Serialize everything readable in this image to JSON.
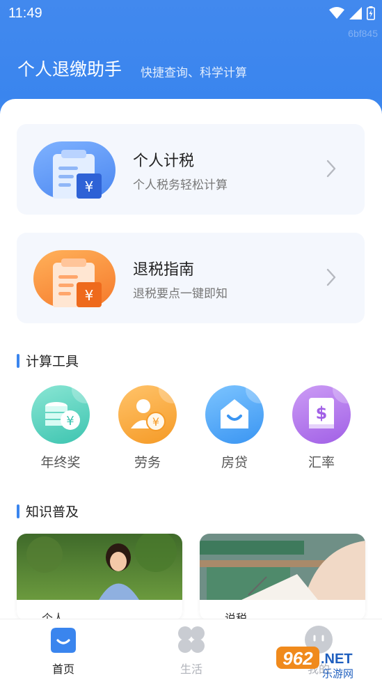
{
  "status_bar": {
    "time": "11:49"
  },
  "watermark_code": "6bf845",
  "header": {
    "title": "个人退缴助手",
    "subtitle": "快捷查询、科学计算"
  },
  "features": [
    {
      "title": "个人计税",
      "subtitle": "个人税务轻松计算",
      "icon": "tax-clipboard-icon",
      "badge": "¥"
    },
    {
      "title": "退税指南",
      "subtitle": "退税要点一键即知",
      "icon": "refund-clipboard-icon",
      "badge": "¥"
    }
  ],
  "tools_section": {
    "title": "计算工具",
    "items": [
      {
        "label": "年终奖",
        "icon": "coins-yen-icon",
        "badge": "¥"
      },
      {
        "label": "劳务",
        "icon": "person-yen-icon",
        "badge": "¥"
      },
      {
        "label": "房贷",
        "icon": "house-icon"
      },
      {
        "label": "汇率",
        "icon": "dollar-book-icon",
        "badge": "$"
      }
    ]
  },
  "knowledge_section": {
    "title": "知识普及",
    "cards": [
      {
        "title": "…个人 …"
      },
      {
        "title": "…说税 …"
      }
    ]
  },
  "tabbar": {
    "items": [
      {
        "label": "首页",
        "active": true
      },
      {
        "label": "生活",
        "active": false
      },
      {
        "label": "我的",
        "active": false
      }
    ]
  },
  "watermark": {
    "number": "962",
    "suffix": ".NET",
    "site": "乐游网"
  },
  "colors": {
    "primary": "#3a85ee",
    "card_bg": "#f4f7fd",
    "orange": "#f5792b",
    "text_main": "#222222",
    "text_sub": "#777777"
  }
}
